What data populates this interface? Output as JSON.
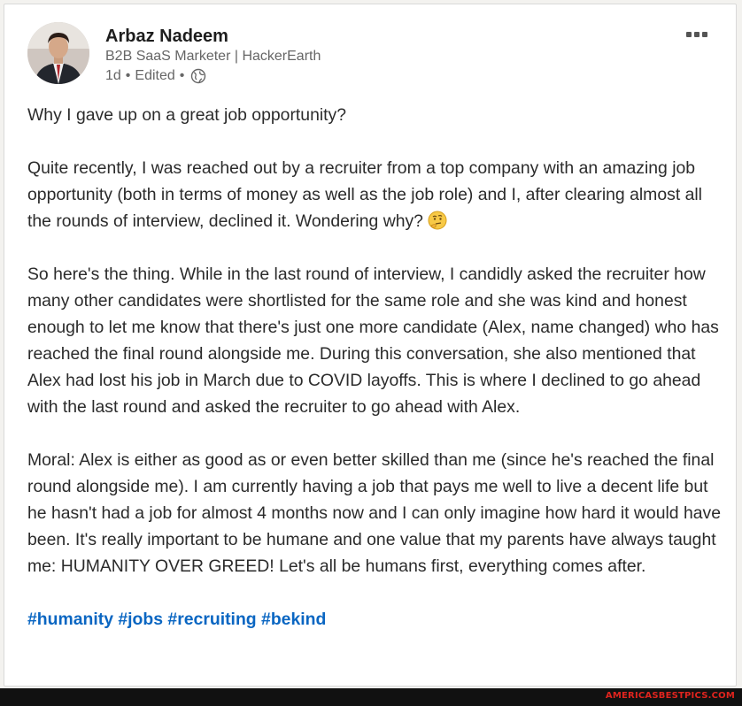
{
  "post": {
    "author": {
      "name": "Arbaz Nadeem",
      "headline": "B2B SaaS Marketer | HackerEarth"
    },
    "time": "1d",
    "edited": "Edited",
    "separator": "•",
    "paragraphs": [
      "Why I gave up on a great job opportunity?",
      "Quite recently, I was reached out by a recruiter from a top company with an amazing job opportunity (both in terms of money as well as the job role) and I, after clearing almost all the rounds of interview, declined it. Wondering why?",
      "So here's the thing. While in the last round of interview, I candidly asked the recruiter how many other candidates were shortlisted for the same role and she was kind and honest enough to let me know that there's just one more candidate (Alex, name changed) who has reached the final round alongside me. During this conversation, she also mentioned that Alex had lost his job in March due to COVID layoffs. This is where I declined to go ahead with the last round and asked the recruiter to go ahead with Alex.",
      "Moral: Alex is either as good as or even better skilled than me (since he's reached the final round alongside me). I am currently having a job that pays me well to live a decent life but he hasn't had a job for almost 4 months now and I can only imagine how hard it would have been. It's really important to be humane and one value that my parents have always taught me: HUMANITY OVER GREED! Let's all be humans first, everything comes after."
    ],
    "hashtags": [
      "#humanity",
      "#jobs",
      "#recruiting",
      "#bekind"
    ]
  },
  "watermark": "AMERICASBESTPICS.COM",
  "colors": {
    "link": "#0a66c2",
    "watermark": "#e0241e"
  },
  "icons": {
    "visibility": "globe-icon",
    "emoji": "thinking-face-emoji",
    "menu": "more-options-icon"
  }
}
